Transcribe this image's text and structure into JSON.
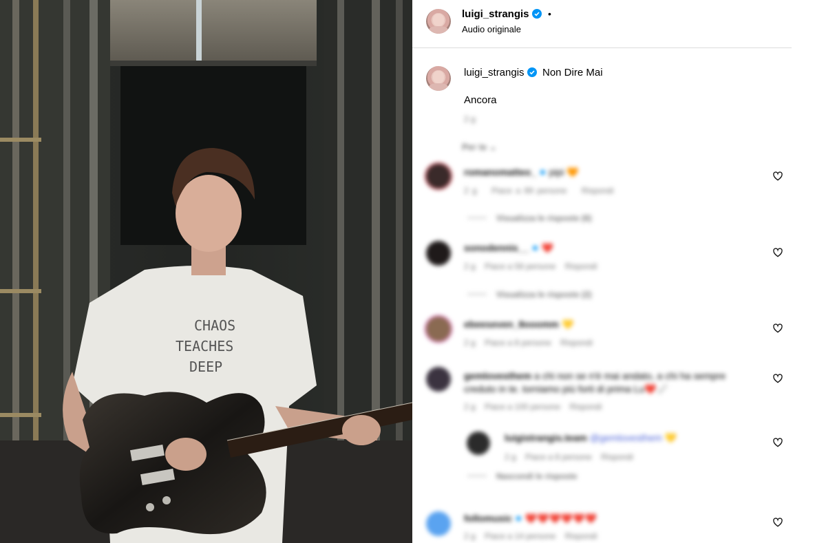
{
  "post_header": {
    "username": "luigi_strangis",
    "dot": "•",
    "audio": "Audio originale"
  },
  "caption": {
    "username": "luigi_strangis",
    "title": "Non Dire Mai",
    "text": "Ancora",
    "time": "2 g"
  },
  "filter": {
    "label": "Per te ⌄"
  },
  "comments": [
    {
      "username": "romanomatteo_",
      "text": "pipi 🧡",
      "time": "2 g",
      "likes": "Piace a 89 persone",
      "reply": "Rispondi",
      "view_replies": "Visualizza le risposte (6)",
      "avatar_color": "#3a2a2a"
    },
    {
      "username": "sonodennis__",
      "text": "❤️",
      "time": "2 g",
      "likes": "Piace a 58 persone",
      "reply": "Rispondi",
      "view_replies": "Visualizza le risposte (2)",
      "avatar_color": "#1f1a1a"
    },
    {
      "username": "ebeeseven_8ooomm",
      "text": "💛",
      "time": "2 g",
      "likes": "Piace a 8 persone",
      "reply": "Rispondi",
      "avatar_color": "#8a6a52"
    },
    {
      "username": "gemlovesthem",
      "text": "a chi non se n'è mai andato, a chi ha sempre creduto in te. torniamo più forti di prima Lu❤️🩹",
      "time": "2 g",
      "likes": "Piace a 100 persone",
      "reply": "Rispondi",
      "avatar_color": "#3b3340"
    },
    {
      "username": "luigistrangis.team",
      "mention": "@gemlovesthem",
      "text": "💛",
      "time": "2 g",
      "likes": "Piace a 8 persone",
      "reply": "Rispondi",
      "hide_replies": "Nascondi le risposte",
      "avatar_color": "#2b2b2b"
    },
    {
      "username": "follomusic",
      "text": "❤️❤️❤️❤️❤️❤️",
      "time": "2 g",
      "likes": "Piace a 14 persone",
      "reply": "Rispondi",
      "avatar_color": "#5aa3f0"
    }
  ],
  "colors": {
    "verified": "#0095f6",
    "border": "#dbdbdb",
    "muted": "#737373",
    "mention": "#4b62d8"
  },
  "icons": {
    "verified": "verified-badge-icon",
    "like": "heart-outline-icon"
  }
}
